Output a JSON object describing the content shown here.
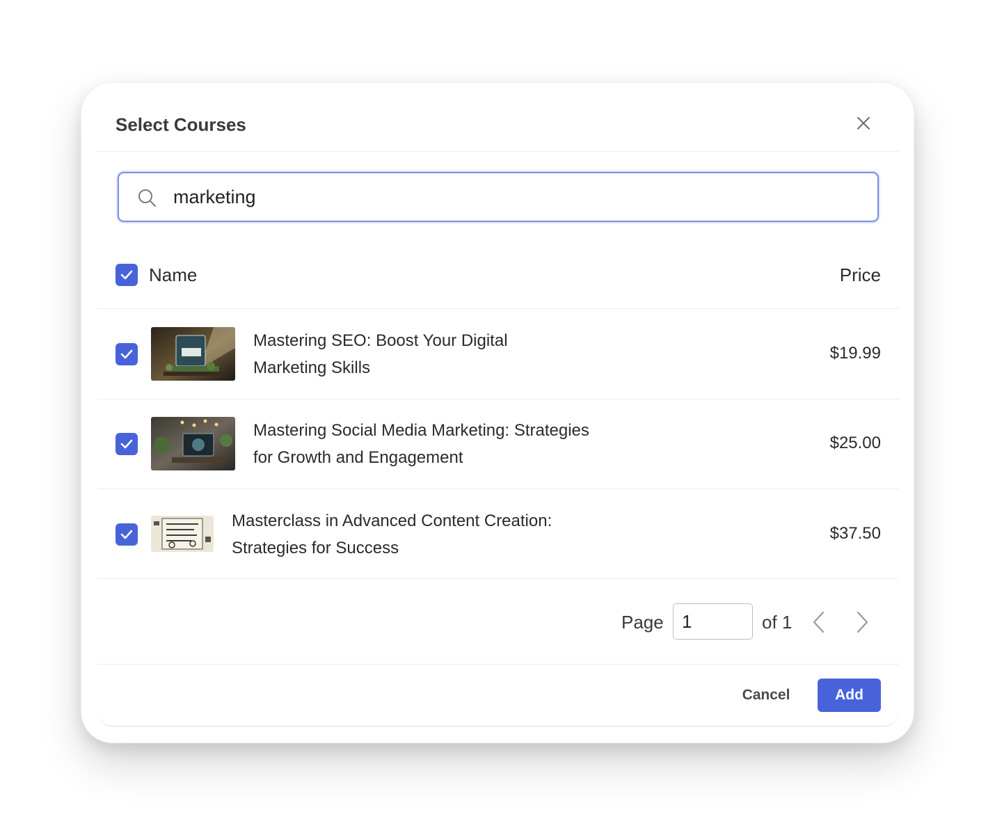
{
  "dialog": {
    "title": "Select Courses",
    "close_icon": "close-icon"
  },
  "search": {
    "value": "marketing",
    "icon": "search-icon"
  },
  "table": {
    "columns": {
      "name": "Name",
      "price": "Price"
    },
    "select_all_checked": true,
    "rows": [
      {
        "checked": true,
        "name_line1": "Mastering SEO: Boost Your Digital",
        "name_line2": "Marketing Skills",
        "price": "$19.99"
      },
      {
        "checked": true,
        "name_line1": "Mastering Social Media Marketing: Strategies",
        "name_line2": "for Growth and Engagement",
        "price": "$25.00"
      },
      {
        "checked": true,
        "name_line1": "Masterclass in Advanced Content Creation:",
        "name_line2": "Strategies for Success",
        "price": "$37.50"
      }
    ]
  },
  "pagination": {
    "page_label": "Page",
    "current_page": "1",
    "of_label": "of 1"
  },
  "footer": {
    "cancel_label": "Cancel",
    "add_label": "Add"
  },
  "colors": {
    "accent": "#4863d9",
    "focus_border": "#7b8ee6"
  }
}
